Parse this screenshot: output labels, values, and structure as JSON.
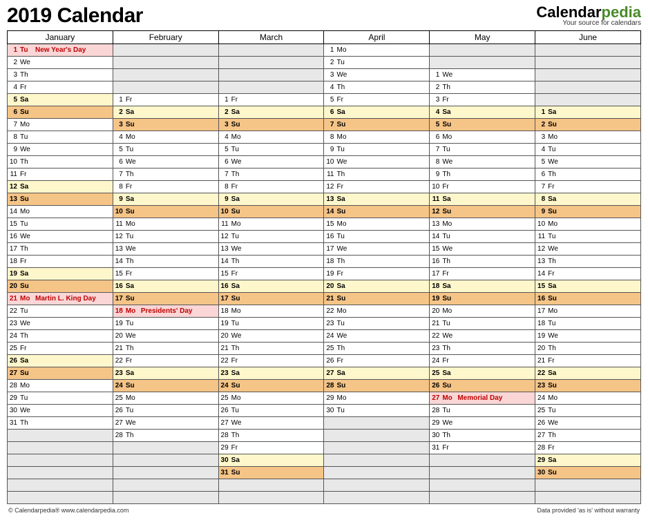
{
  "title": "2019 Calendar",
  "brand": {
    "name1": "Calendar",
    "name2": "pedia",
    "tag": "Your source for calendars"
  },
  "footer_left": "© Calendarpedia®   www.calendarpedia.com",
  "footer_right": "Data provided 'as is' without warranty",
  "rows": 37,
  "months": [
    {
      "name": "January",
      "offset": 0,
      "days": [
        {
          "d": 1,
          "w": "Tu",
          "t": "hol",
          "e": "New Year's Day"
        },
        {
          "d": 2,
          "w": "We"
        },
        {
          "d": 3,
          "w": "Th"
        },
        {
          "d": 4,
          "w": "Fr"
        },
        {
          "d": 5,
          "w": "Sa",
          "t": "sa"
        },
        {
          "d": 6,
          "w": "Su",
          "t": "su"
        },
        {
          "d": 7,
          "w": "Mo"
        },
        {
          "d": 8,
          "w": "Tu"
        },
        {
          "d": 9,
          "w": "We"
        },
        {
          "d": 10,
          "w": "Th"
        },
        {
          "d": 11,
          "w": "Fr"
        },
        {
          "d": 12,
          "w": "Sa",
          "t": "sa"
        },
        {
          "d": 13,
          "w": "Su",
          "t": "su"
        },
        {
          "d": 14,
          "w": "Mo"
        },
        {
          "d": 15,
          "w": "Tu"
        },
        {
          "d": 16,
          "w": "We"
        },
        {
          "d": 17,
          "w": "Th"
        },
        {
          "d": 18,
          "w": "Fr"
        },
        {
          "d": 19,
          "w": "Sa",
          "t": "sa"
        },
        {
          "d": 20,
          "w": "Su",
          "t": "su"
        },
        {
          "d": 21,
          "w": "Mo",
          "t": "hol",
          "e": "Martin L. King Day"
        },
        {
          "d": 22,
          "w": "Tu"
        },
        {
          "d": 23,
          "w": "We"
        },
        {
          "d": 24,
          "w": "Th"
        },
        {
          "d": 25,
          "w": "Fr"
        },
        {
          "d": 26,
          "w": "Sa",
          "t": "sa"
        },
        {
          "d": 27,
          "w": "Su",
          "t": "su"
        },
        {
          "d": 28,
          "w": "Mo"
        },
        {
          "d": 29,
          "w": "Tu"
        },
        {
          "d": 30,
          "w": "We"
        },
        {
          "d": 31,
          "w": "Th"
        }
      ]
    },
    {
      "name": "February",
      "offset": 4,
      "days": [
        {
          "d": 1,
          "w": "Fr"
        },
        {
          "d": 2,
          "w": "Sa",
          "t": "sa"
        },
        {
          "d": 3,
          "w": "Su",
          "t": "su"
        },
        {
          "d": 4,
          "w": "Mo"
        },
        {
          "d": 5,
          "w": "Tu"
        },
        {
          "d": 6,
          "w": "We"
        },
        {
          "d": 7,
          "w": "Th"
        },
        {
          "d": 8,
          "w": "Fr"
        },
        {
          "d": 9,
          "w": "Sa",
          "t": "sa"
        },
        {
          "d": 10,
          "w": "Su",
          "t": "su"
        },
        {
          "d": 11,
          "w": "Mo"
        },
        {
          "d": 12,
          "w": "Tu"
        },
        {
          "d": 13,
          "w": "We"
        },
        {
          "d": 14,
          "w": "Th"
        },
        {
          "d": 15,
          "w": "Fr"
        },
        {
          "d": 16,
          "w": "Sa",
          "t": "sa"
        },
        {
          "d": 17,
          "w": "Su",
          "t": "su"
        },
        {
          "d": 18,
          "w": "Mo",
          "t": "hol",
          "e": "Presidents' Day"
        },
        {
          "d": 19,
          "w": "Tu"
        },
        {
          "d": 20,
          "w": "We"
        },
        {
          "d": 21,
          "w": "Th"
        },
        {
          "d": 22,
          "w": "Fr"
        },
        {
          "d": 23,
          "w": "Sa",
          "t": "sa"
        },
        {
          "d": 24,
          "w": "Su",
          "t": "su"
        },
        {
          "d": 25,
          "w": "Mo"
        },
        {
          "d": 26,
          "w": "Tu"
        },
        {
          "d": 27,
          "w": "We"
        },
        {
          "d": 28,
          "w": "Th"
        }
      ]
    },
    {
      "name": "March",
      "offset": 4,
      "days": [
        {
          "d": 1,
          "w": "Fr"
        },
        {
          "d": 2,
          "w": "Sa",
          "t": "sa"
        },
        {
          "d": 3,
          "w": "Su",
          "t": "su"
        },
        {
          "d": 4,
          "w": "Mo"
        },
        {
          "d": 5,
          "w": "Tu"
        },
        {
          "d": 6,
          "w": "We"
        },
        {
          "d": 7,
          "w": "Th"
        },
        {
          "d": 8,
          "w": "Fr"
        },
        {
          "d": 9,
          "w": "Sa",
          "t": "sa"
        },
        {
          "d": 10,
          "w": "Su",
          "t": "su"
        },
        {
          "d": 11,
          "w": "Mo"
        },
        {
          "d": 12,
          "w": "Tu"
        },
        {
          "d": 13,
          "w": "We"
        },
        {
          "d": 14,
          "w": "Th"
        },
        {
          "d": 15,
          "w": "Fr"
        },
        {
          "d": 16,
          "w": "Sa",
          "t": "sa"
        },
        {
          "d": 17,
          "w": "Su",
          "t": "su"
        },
        {
          "d": 18,
          "w": "Mo"
        },
        {
          "d": 19,
          "w": "Tu"
        },
        {
          "d": 20,
          "w": "We"
        },
        {
          "d": 21,
          "w": "Th"
        },
        {
          "d": 22,
          "w": "Fr"
        },
        {
          "d": 23,
          "w": "Sa",
          "t": "sa"
        },
        {
          "d": 24,
          "w": "Su",
          "t": "su"
        },
        {
          "d": 25,
          "w": "Mo"
        },
        {
          "d": 26,
          "w": "Tu"
        },
        {
          "d": 27,
          "w": "We"
        },
        {
          "d": 28,
          "w": "Th"
        },
        {
          "d": 29,
          "w": "Fr"
        },
        {
          "d": 30,
          "w": "Sa",
          "t": "sa"
        },
        {
          "d": 31,
          "w": "Su",
          "t": "su"
        }
      ]
    },
    {
      "name": "April",
      "offset": 0,
      "days": [
        {
          "d": 1,
          "w": "Mo"
        },
        {
          "d": 2,
          "w": "Tu"
        },
        {
          "d": 3,
          "w": "We"
        },
        {
          "d": 4,
          "w": "Th"
        },
        {
          "d": 5,
          "w": "Fr"
        },
        {
          "d": 6,
          "w": "Sa",
          "t": "sa"
        },
        {
          "d": 7,
          "w": "Su",
          "t": "su"
        },
        {
          "d": 8,
          "w": "Mo"
        },
        {
          "d": 9,
          "w": "Tu"
        },
        {
          "d": 10,
          "w": "We"
        },
        {
          "d": 11,
          "w": "Th"
        },
        {
          "d": 12,
          "w": "Fr"
        },
        {
          "d": 13,
          "w": "Sa",
          "t": "sa"
        },
        {
          "d": 14,
          "w": "Su",
          "t": "su"
        },
        {
          "d": 15,
          "w": "Mo"
        },
        {
          "d": 16,
          "w": "Tu"
        },
        {
          "d": 17,
          "w": "We"
        },
        {
          "d": 18,
          "w": "Th"
        },
        {
          "d": 19,
          "w": "Fr"
        },
        {
          "d": 20,
          "w": "Sa",
          "t": "sa"
        },
        {
          "d": 21,
          "w": "Su",
          "t": "su"
        },
        {
          "d": 22,
          "w": "Mo"
        },
        {
          "d": 23,
          "w": "Tu"
        },
        {
          "d": 24,
          "w": "We"
        },
        {
          "d": 25,
          "w": "Th"
        },
        {
          "d": 26,
          "w": "Fr"
        },
        {
          "d": 27,
          "w": "Sa",
          "t": "sa"
        },
        {
          "d": 28,
          "w": "Su",
          "t": "su"
        },
        {
          "d": 29,
          "w": "Mo"
        },
        {
          "d": 30,
          "w": "Tu"
        }
      ]
    },
    {
      "name": "May",
      "offset": 2,
      "days": [
        {
          "d": 1,
          "w": "We"
        },
        {
          "d": 2,
          "w": "Th"
        },
        {
          "d": 3,
          "w": "Fr"
        },
        {
          "d": 4,
          "w": "Sa",
          "t": "sa"
        },
        {
          "d": 5,
          "w": "Su",
          "t": "su"
        },
        {
          "d": 6,
          "w": "Mo"
        },
        {
          "d": 7,
          "w": "Tu"
        },
        {
          "d": 8,
          "w": "We"
        },
        {
          "d": 9,
          "w": "Th"
        },
        {
          "d": 10,
          "w": "Fr"
        },
        {
          "d": 11,
          "w": "Sa",
          "t": "sa"
        },
        {
          "d": 12,
          "w": "Su",
          "t": "su"
        },
        {
          "d": 13,
          "w": "Mo"
        },
        {
          "d": 14,
          "w": "Tu"
        },
        {
          "d": 15,
          "w": "We"
        },
        {
          "d": 16,
          "w": "Th"
        },
        {
          "d": 17,
          "w": "Fr"
        },
        {
          "d": 18,
          "w": "Sa",
          "t": "sa"
        },
        {
          "d": 19,
          "w": "Su",
          "t": "su"
        },
        {
          "d": 20,
          "w": "Mo"
        },
        {
          "d": 21,
          "w": "Tu"
        },
        {
          "d": 22,
          "w": "We"
        },
        {
          "d": 23,
          "w": "Th"
        },
        {
          "d": 24,
          "w": "Fr"
        },
        {
          "d": 25,
          "w": "Sa",
          "t": "sa"
        },
        {
          "d": 26,
          "w": "Su",
          "t": "su"
        },
        {
          "d": 27,
          "w": "Mo",
          "t": "hol",
          "e": "Memorial Day"
        },
        {
          "d": 28,
          "w": "Tu"
        },
        {
          "d": 29,
          "w": "We"
        },
        {
          "d": 30,
          "w": "Th"
        },
        {
          "d": 31,
          "w": "Fr"
        }
      ]
    },
    {
      "name": "June",
      "offset": 5,
      "days": [
        {
          "d": 1,
          "w": "Sa",
          "t": "sa"
        },
        {
          "d": 2,
          "w": "Su",
          "t": "su"
        },
        {
          "d": 3,
          "w": "Mo"
        },
        {
          "d": 4,
          "w": "Tu"
        },
        {
          "d": 5,
          "w": "We"
        },
        {
          "d": 6,
          "w": "Th"
        },
        {
          "d": 7,
          "w": "Fr"
        },
        {
          "d": 8,
          "w": "Sa",
          "t": "sa"
        },
        {
          "d": 9,
          "w": "Su",
          "t": "su"
        },
        {
          "d": 10,
          "w": "Mo"
        },
        {
          "d": 11,
          "w": "Tu"
        },
        {
          "d": 12,
          "w": "We"
        },
        {
          "d": 13,
          "w": "Th"
        },
        {
          "d": 14,
          "w": "Fr"
        },
        {
          "d": 15,
          "w": "Sa",
          "t": "sa"
        },
        {
          "d": 16,
          "w": "Su",
          "t": "su"
        },
        {
          "d": 17,
          "w": "Mo"
        },
        {
          "d": 18,
          "w": "Tu"
        },
        {
          "d": 19,
          "w": "We"
        },
        {
          "d": 20,
          "w": "Th"
        },
        {
          "d": 21,
          "w": "Fr"
        },
        {
          "d": 22,
          "w": "Sa",
          "t": "sa"
        },
        {
          "d": 23,
          "w": "Su",
          "t": "su"
        },
        {
          "d": 24,
          "w": "Mo"
        },
        {
          "d": 25,
          "w": "Tu"
        },
        {
          "d": 26,
          "w": "We"
        },
        {
          "d": 27,
          "w": "Th"
        },
        {
          "d": 28,
          "w": "Fr"
        },
        {
          "d": 29,
          "w": "Sa",
          "t": "sa"
        },
        {
          "d": 30,
          "w": "Su",
          "t": "su"
        }
      ]
    }
  ]
}
